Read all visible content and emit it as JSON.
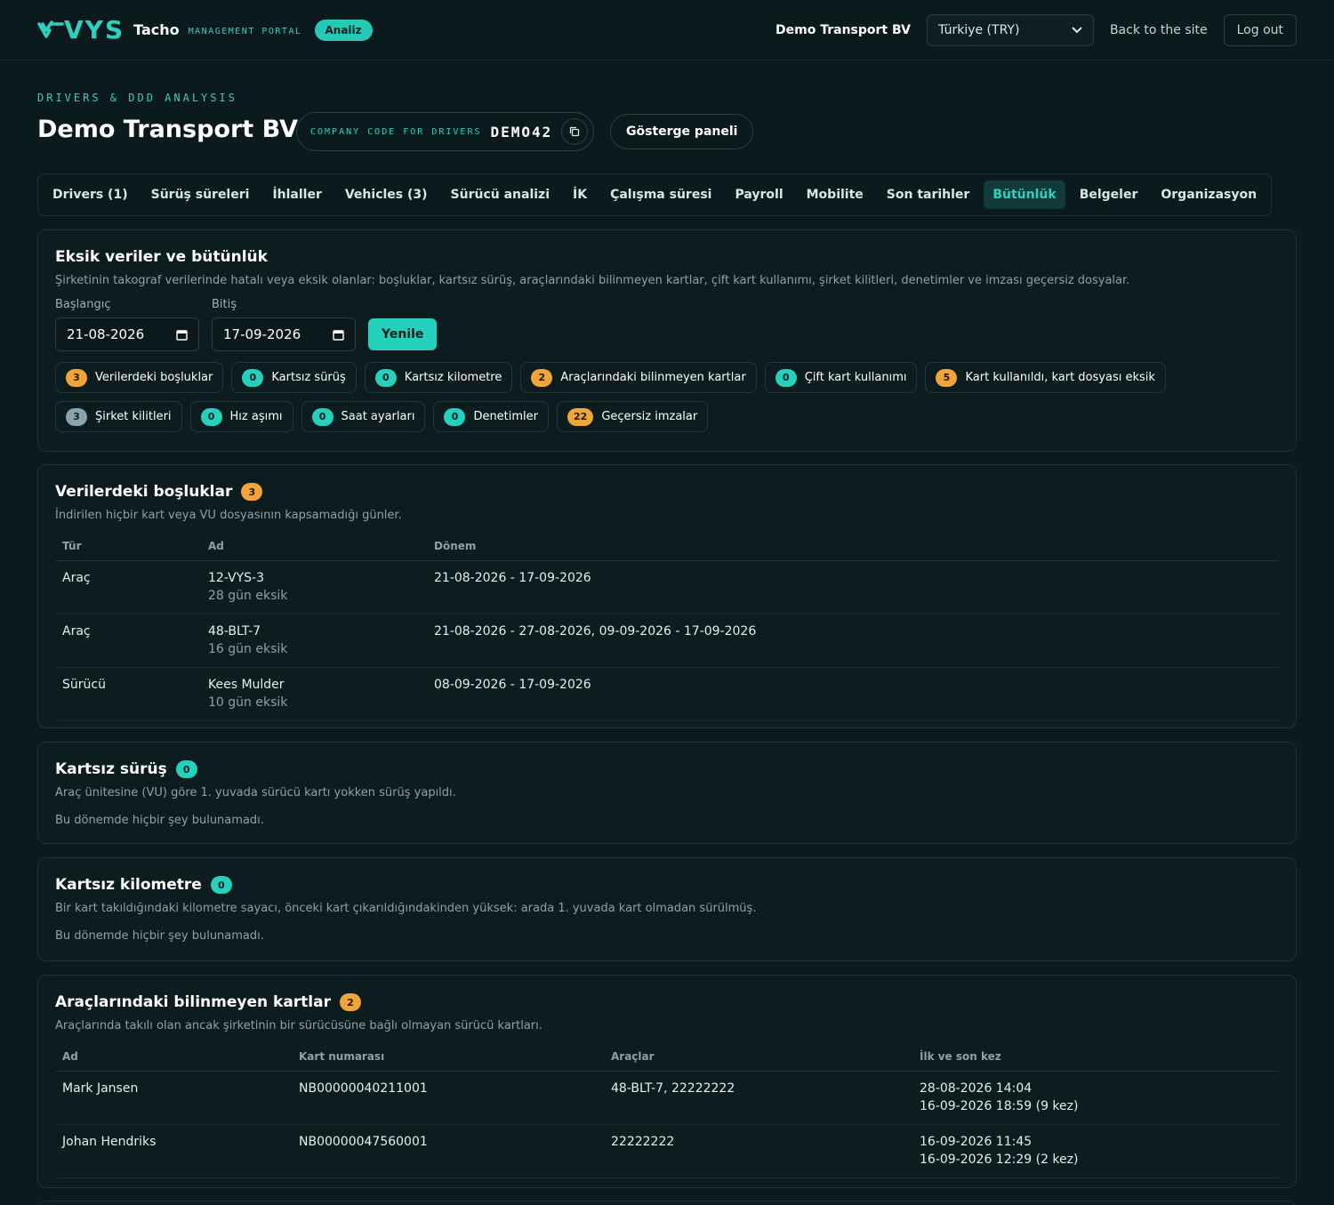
{
  "header": {
    "logo_text": "VYS",
    "brand": "Tacho",
    "brand_sub": "MANAGEMENT PORTAL",
    "pill": "Analiz",
    "company": "Demo Transport BV",
    "region_select": "Türkiye (TRY)",
    "back_link": "Back to the site",
    "logout": "Log out"
  },
  "page": {
    "eyebrow": "DRIVERS & DDD ANALYSIS",
    "title": "Demo Transport BV",
    "code_label": "COMPANY CODE FOR DRIVERS",
    "code_value": "DEMO42",
    "dashboard_button": "Gösterge paneli"
  },
  "tabs": [
    "Drivers (1)",
    "Sürüş süreleri",
    "İhlaller",
    "Vehicles (3)",
    "Sürücü analizi",
    "İK",
    "Çalışma süresi",
    "Payroll",
    "Mobilite",
    "Son tarihler",
    "Bütünlük",
    "Belgeler",
    "Organizasyon"
  ],
  "active_tab": "Bütünlük",
  "integrity": {
    "title": "Eksik veriler ve bütünlük",
    "desc": "Şirketinin takograf verilerinde hatalı veya eksik olanlar: boşluklar, kartsız sürüş, araçlarındaki bilinmeyen kartlar, çift kart kullanımı, şirket kilitleri, denetimler ve imzası geçersiz dosyalar.",
    "start_label": "Başlangıç",
    "end_label": "Bitiş",
    "start_value": "21-08-2026",
    "end_value": "17-09-2026",
    "refresh": "Yenile",
    "chips": [
      {
        "count": "3",
        "label": "Verilerdeki boşluklar",
        "color": "orange"
      },
      {
        "count": "0",
        "label": "Kartsız sürüş",
        "color": "teal"
      },
      {
        "count": "0",
        "label": "Kartsız kilometre",
        "color": "teal"
      },
      {
        "count": "2",
        "label": "Araçlarındaki bilinmeyen kartlar",
        "color": "orange"
      },
      {
        "count": "0",
        "label": "Çift kart kullanımı",
        "color": "teal"
      },
      {
        "count": "5",
        "label": "Kart kullanıldı, kart dosyası eksik",
        "color": "orange"
      },
      {
        "count": "3",
        "label": "Şirket kilitleri",
        "color": "slate"
      },
      {
        "count": "0",
        "label": "Hız aşımı",
        "color": "teal"
      },
      {
        "count": "0",
        "label": "Saat ayarları",
        "color": "teal"
      },
      {
        "count": "0",
        "label": "Denetimler",
        "color": "teal"
      },
      {
        "count": "22",
        "label": "Geçersiz imzalar",
        "color": "orange"
      }
    ]
  },
  "gaps": {
    "title": "Verilerdeki boşluklar",
    "count": "3",
    "desc": "İndirilen hiçbir kart veya VU dosyasının kapsamadığı günler.",
    "columns": [
      "Tür",
      "Ad",
      "Dönem"
    ],
    "rows": [
      {
        "type": "Araç",
        "name": "12-VYS-3",
        "missing": "28 gün eksik",
        "period": "21-08-2026 - 17-09-2026"
      },
      {
        "type": "Araç",
        "name": "48-BLT-7",
        "missing": "16 gün eksik",
        "period": "21-08-2026 - 27-08-2026, 09-09-2026 - 17-09-2026"
      },
      {
        "type": "Sürücü",
        "name": "Kees Mulder",
        "missing": "10 gün eksik",
        "period": "08-09-2026 - 17-09-2026"
      }
    ]
  },
  "cardless": {
    "title": "Kartsız sürüş",
    "count": "0",
    "desc": "Araç ünitesine (VU) göre 1. yuvada sürücü kartı yokken sürüş yapıldı.",
    "empty": "Bu dönemde hiçbir şey bulunamadı."
  },
  "cardless_km": {
    "title": "Kartsız kilometre",
    "count": "0",
    "desc": "Bir kart takıldığındaki kilometre sayacı, önceki kart çıkarıldığındakinden yüksek: arada 1. yuvada kart olmadan sürülmüş.",
    "empty": "Bu dönemde hiçbir şey bulunamadı."
  },
  "unknown_cards": {
    "title": "Araçlarındaki bilinmeyen kartlar",
    "count": "2",
    "desc": "Araçlarında takılı olan ancak şirketinin bir sürücüsüne bağlı olmayan sürücü kartları.",
    "columns": [
      "Ad",
      "Kart numarası",
      "Araçlar",
      "İlk ve son kez"
    ],
    "rows": [
      {
        "name": "Mark Jansen",
        "card": "NB00000040211001",
        "vehicles": "48-BLT-7, 22222222",
        "first": "28-08-2026 14:04",
        "last": "16-09-2026 18:59 (9 kez)"
      },
      {
        "name": "Johan Hendriks",
        "card": "NB00000047560001",
        "vehicles": "22222222",
        "first": "16-09-2026 11:45",
        "last": "16-09-2026 12:29 (2 kez)"
      }
    ]
  },
  "colors": {
    "accent": "#2ed1c0",
    "orange": "#f0a53a",
    "slate": "#8aa3ad",
    "bg": "#0b1a1d"
  }
}
